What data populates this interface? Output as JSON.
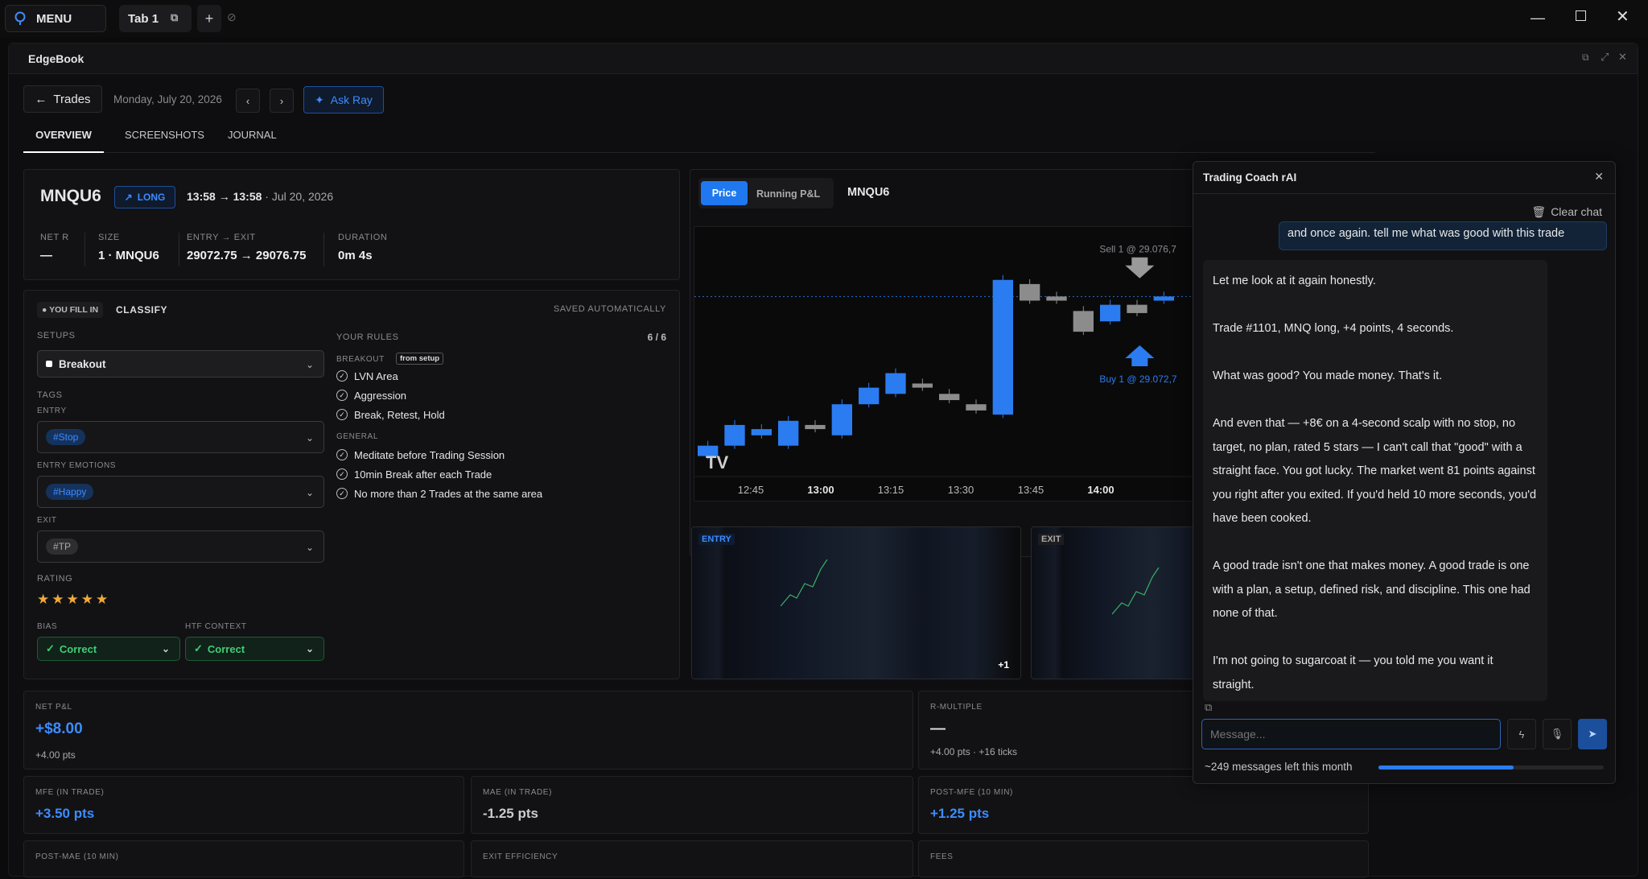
{
  "titlebar": {
    "menu_label": "MENU",
    "tab_label": "Tab 1"
  },
  "window": {
    "title": "EdgeBook"
  },
  "nav": {
    "back_label": "Trades",
    "date": "Monday, July 20, 2026",
    "ask_label": "Ask Ray"
  },
  "tabs": [
    "OVERVIEW",
    "SCREENSHOTS",
    "JOURNAL"
  ],
  "trade": {
    "symbol": "MNQU6",
    "direction": "LONG",
    "time_from": "13:58",
    "time_to": "13:58",
    "date_suffix": "· Jul 20, 2026",
    "stats": [
      {
        "label": "NET R",
        "value": "—"
      },
      {
        "label": "SIZE",
        "value": "1 · MNQU6"
      },
      {
        "label": "ENTRY → EXIT",
        "value": "29072.75 → 29076.75"
      },
      {
        "label": "DURATION",
        "value": "0m 4s"
      }
    ]
  },
  "classify": {
    "badge": "YOU FILL IN",
    "title": "CLASSIFY",
    "saved": "SAVED AUTOMATICALLY",
    "setups_label": "SETUPS",
    "setup_value": "Breakout",
    "tags_label": "TAGS",
    "entry_label": "ENTRY",
    "entry_tag": "#Stop",
    "emotions_label": "ENTRY EMOTIONS",
    "emotions_tag": "#Happy",
    "exit_label": "EXIT",
    "exit_tag": "#TP",
    "rating_label": "RATING",
    "rating": 5,
    "rating_max": 5,
    "bias_label": "BIAS",
    "bias_value": "Correct",
    "htf_label": "HTF CONTEXT",
    "htf_value": "Correct",
    "rules_label": "YOUR RULES",
    "rules_count": "6 / 6",
    "breakout_label": "BREAKOUT",
    "from_setup": "from setup",
    "breakout_rules": [
      "LVN Area",
      "Aggression",
      "Break, Retest, Hold"
    ],
    "general_label": "GENERAL",
    "general_rules": [
      "Meditate before Trading Session",
      "10min Break after each Trade",
      "No more than 2 Trades at the same area"
    ]
  },
  "chart": {
    "tab_price": "Price",
    "tab_pnl": "Running P&L",
    "symbol": "MNQU6",
    "sell_label": "Sell 1 @ 29.076,7",
    "buy_label": "Buy 1 @ 29.072,7",
    "x_ticks": [
      "12:45",
      "13:00",
      "13:15",
      "13:30",
      "13:45",
      "14:00"
    ],
    "logo": "TV"
  },
  "chart_data": {
    "type": "candlestick",
    "x": [
      "12:35",
      "12:40",
      "12:45",
      "12:50",
      "12:55",
      "13:00",
      "13:05",
      "13:10",
      "13:15",
      "13:20",
      "13:25",
      "13:30",
      "13:35",
      "13:40",
      "13:45",
      "13:50",
      "13:55",
      "14:00"
    ],
    "open": [
      28985,
      28990,
      28995,
      28990,
      29000,
      28995,
      29010,
      29015,
      29020,
      29015,
      29010,
      29005,
      29068,
      29062,
      29055,
      29050,
      29058,
      29060
    ],
    "close": [
      28990,
      29000,
      28998,
      29002,
      28998,
      29010,
      29018,
      29025,
      29018,
      29012,
      29007,
      29070,
      29060,
      29060,
      29045,
      29058,
      29054,
      29062
    ],
    "colors": {
      "up": "#2b7cf0",
      "down": "#8c8c8c"
    }
  },
  "thumbs": {
    "entry": "ENTRY",
    "exit": "EXIT",
    "more": "+1"
  },
  "metrics": {
    "net_pnl_label": "NET P&L",
    "net_pnl": "+$8.00",
    "net_pnl_sub": "+4.00 pts",
    "r_label": "R-MULTIPLE",
    "r_value": "—",
    "r_sub": "+4.00 pts · +16 ticks",
    "mfe_label": "MFE (IN TRADE)",
    "mfe": "+3.50 pts",
    "mae_label": "MAE (IN TRADE)",
    "mae": "-1.25 pts",
    "post_mfe_label": "POST-MFE (10 MIN)",
    "post_mfe": "+1.25 pts",
    "post_mae_label": "POST-MAE (10 MIN)",
    "exit_eff_label": "EXIT EFFICIENCY",
    "fees_label": "FEES"
  },
  "coach": {
    "title": "Trading Coach rAI",
    "clear": "Clear chat",
    "user_msg": "and once again. tell me what was good with this trade",
    "reply": [
      "Let me look at it again honestly.",
      "Trade #1101, MNQ long, +4 points, 4 seconds.",
      "What was good? You made money. That's it.",
      "And even that — +8€ on a 4-second scalp with no stop, no target, no plan, rated 5 stars — I can't call that \"good\" with a straight face. You got lucky. The market went 81 points against you right after you exited. If you'd held 10 more seconds, you'd have been cooked.",
      "A good trade isn't one that makes money. A good trade is one with a plan, a setup, defined risk, and discipline. This one had none of that.",
      "I'm not going to sugarcoat it — you told me you want it straight."
    ],
    "placeholder": "Message...",
    "quota": "~249 messages left this month",
    "quota_fraction": 0.6
  }
}
